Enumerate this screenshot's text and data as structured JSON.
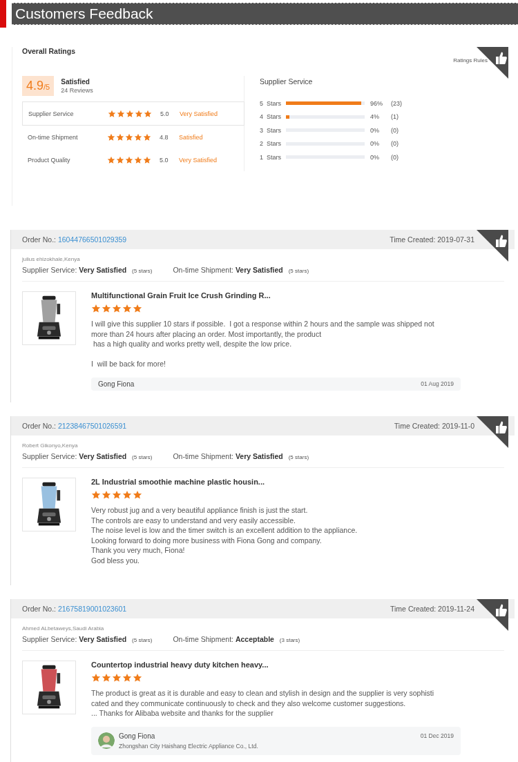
{
  "header": {
    "title": "Customers Feedback"
  },
  "overall": {
    "title": "Overall Ratings",
    "rules_link": "Ratings Rules",
    "score": "4.9",
    "score_max": "/5",
    "verdict": "Satisfied",
    "reviews": "24 Reviews",
    "categories": [
      {
        "name": "Supplier Service",
        "stars": 5,
        "value": "5.0",
        "verdict": "Very Satisfied",
        "selected": true
      },
      {
        "name": "On-time Shipment",
        "stars": 5,
        "value": "4.8",
        "verdict": "Satisfied",
        "selected": false
      },
      {
        "name": "Product Quality",
        "stars": 5,
        "value": "5.0",
        "verdict": "Very Satisfied",
        "selected": false
      }
    ],
    "breakdown": {
      "title": "Supplier Service",
      "rows": [
        {
          "label": "5  Stars",
          "level": 0.96,
          "percent": "96%",
          "count": "(23)"
        },
        {
          "label": "4  Stars",
          "level": 0.04,
          "percent": "4%",
          "count": "(1)"
        },
        {
          "label": "3  Stars",
          "level": 0,
          "percent": "0%",
          "count": "(0)"
        },
        {
          "label": "2  Stars",
          "level": 0,
          "percent": "0%",
          "count": "(0)"
        },
        {
          "label": "1  Stars",
          "level": 0,
          "percent": "0%",
          "count": "(0)"
        }
      ]
    }
  },
  "reviews": [
    {
      "order_label": "Order No.:",
      "order_no": "16044766501029359",
      "time": "Time Created: 2019-07-31",
      "buyer": "julius ehizokhale,Kenya",
      "supplier_label": "Supplier Service:",
      "supplier_rating": "Very Satisfied",
      "supplier_stars": "(5 stars)",
      "shipment_label": "On-time Shipment:",
      "shipment_rating": "Very Satisfied",
      "shipment_stars": "(5 stars)",
      "product": "Multifunctional Grain Fruit Ice Crush Grinding R...",
      "stars": 5,
      "text": "I will give this supplier 10 stars if possible.  I got a response within 2 hours and the sample was shipped not\nmore than 24 hours after placing an order. Most importantly, the product\n has a high quality and works pretty well, despite the low price.\n\nI  will be back for more!",
      "reply": {
        "name": "Gong Fiona",
        "date": "01 Aug 2019"
      }
    },
    {
      "order_label": "Order No.:",
      "order_no": "21238467501026591",
      "time": "Time Created: 2019-11-0",
      "buyer": "Robert Gikonyo,Kenya",
      "supplier_label": "Supplier Service:",
      "supplier_rating": "Very Satisfied",
      "supplier_stars": "(5 stars)",
      "shipment_label": "On-time Shipment:",
      "shipment_rating": "Very Satisfied",
      "shipment_stars": "(5 stars)",
      "product": "2L Industrial smoothie machine plastic housin...",
      "stars": 5,
      "text": "Very robust jug and a very beautiful appliance finish is just the start.\nThe controls are easy to understand and very easily accessible.\nThe noise level is low and the timer switch is an excellent addition to the appliance.\nLooking forward to doing more business with Fiona Gong and company.\nThank you very much, Fiona!\nGod bless you."
    },
    {
      "order_label": "Order No.:",
      "order_no": "21675819001023601",
      "time": "Time Created: 2019-11-24",
      "buyer": "Ahmed ALbetaweys,Saudi Arabia",
      "supplier_label": "Supplier Service:",
      "supplier_rating": "Very Satisfied",
      "supplier_stars": "(5 stars)",
      "shipment_label": "On-time Shipment:",
      "shipment_rating": "Acceptable",
      "shipment_stars": "(3 stars)",
      "product": "Countertop industrial heavy duty kitchen heavy...",
      "stars": 5,
      "text": "The product is great as it is durable and easy to clean and stylish in design and the supplier is very sophisti\ncated and they communicate continuously to check and they also welcome customer suggestions.\n... Thanks for Alibaba website and thanks for the supplier",
      "reply": {
        "name": "Gong Fiona",
        "company": "Zhongshan City Haishang Electric Appliance Co., Ltd.",
        "date": "01 Dec 2019"
      }
    }
  ]
}
